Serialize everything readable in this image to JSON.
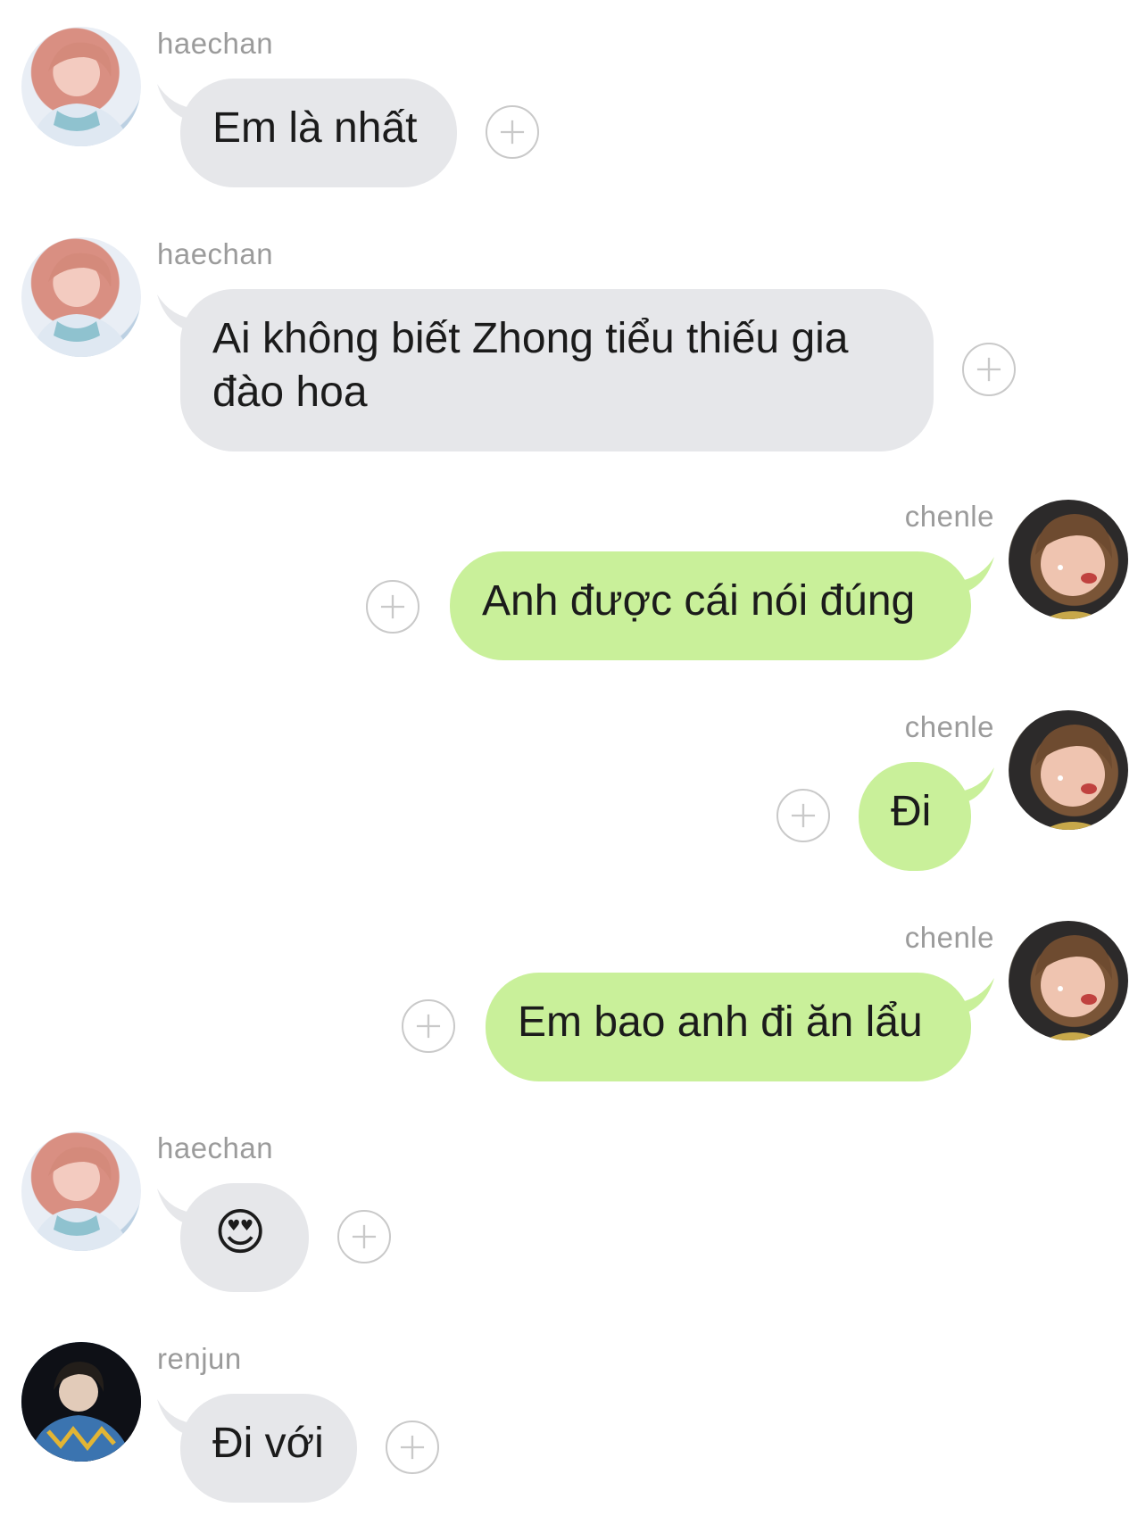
{
  "messages": [
    {
      "sender": "haechan",
      "text": "Em là nhất",
      "direction": "in"
    },
    {
      "sender": "haechan",
      "text": "Ai không biết Zhong tiểu thiếu gia đào hoa",
      "direction": "in"
    },
    {
      "sender": "chenle",
      "text": "Anh được cái nói đúng",
      "direction": "out"
    },
    {
      "sender": "chenle",
      "text": "Đi",
      "direction": "out"
    },
    {
      "sender": "chenle",
      "text": "Em bao anh đi ăn lẩu",
      "direction": "out"
    },
    {
      "sender": "haechan",
      "text": "😍",
      "direction": "in"
    },
    {
      "sender": "renjun",
      "text": "Đi với",
      "direction": "in"
    }
  ],
  "colors": {
    "incoming_bubble": "#e6e7ea",
    "outgoing_bubble": "#c9f09a",
    "sender_name": "#9b9b9b",
    "add_reaction_icon": "#c9c9c9"
  },
  "icons": {
    "add_reaction": "plus-circle-icon",
    "avatar": "profile-photo"
  }
}
